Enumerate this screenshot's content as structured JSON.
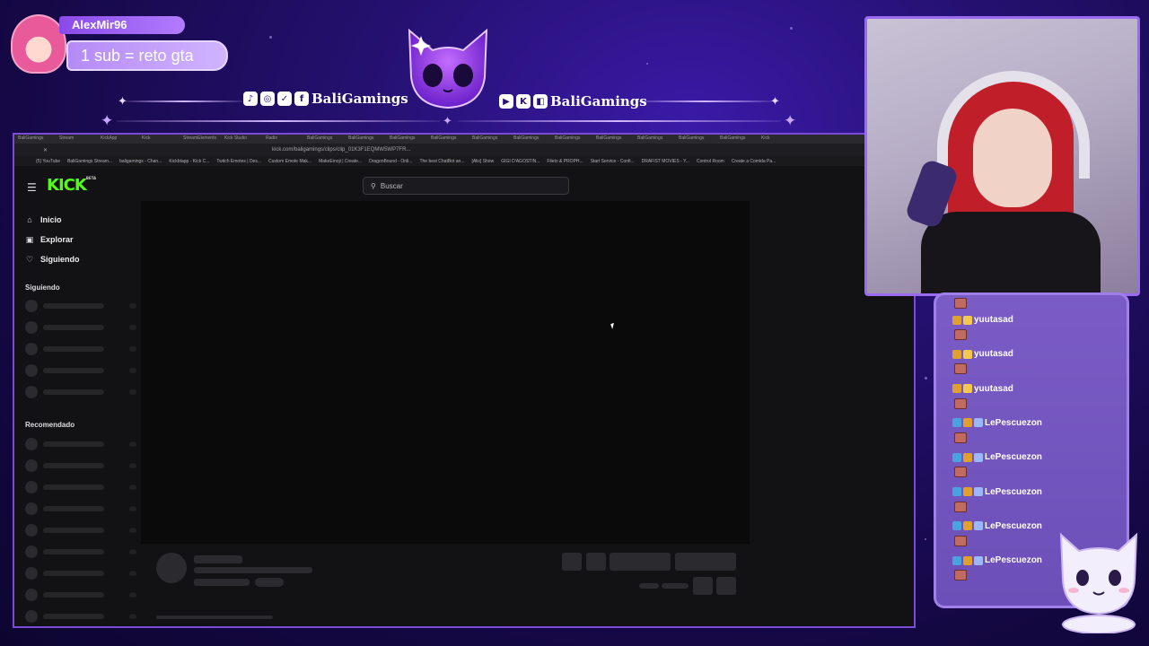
{
  "alert": {
    "username": "AlexMir96",
    "message": "1 sub = reto gta"
  },
  "socials": {
    "left_handle": "BaliGamings",
    "right_handle": "BaliGamings",
    "left_icons": [
      "tiktok-icon",
      "instagram-icon",
      "twitter-icon",
      "facebook-icon"
    ],
    "right_icons": [
      "youtube-icon",
      "kick-icon",
      "twitch-icon"
    ]
  },
  "browser": {
    "tabs": [
      "BaliGamings",
      "Stream",
      "KickApp",
      "Kick",
      "StreamElements",
      "Kick Studio",
      "Radio",
      "BaliGamings",
      "BaliGamings",
      "BaliGamings",
      "BaliGamings",
      "BaliGamings",
      "BaliGamings",
      "BaliGamings",
      "BaliGamings",
      "BaliGamings",
      "BaliGamings",
      "BaliGamings",
      "Kick"
    ],
    "url": "kick.com/baligamings/clips/clip_01K3F1EQMW5WP7FR...",
    "bookmarks": [
      "(5) YouTube",
      "BaliGamings Stream...",
      "baligamings - Chan...",
      "Kickbtapp - Kick C...",
      "Twitch Emotes | Des...",
      "Custom Emote Mak...",
      "MakeEmoji | Create...",
      "DragonBound - Onli...",
      "The best ChatBot an...",
      "[Alix] Show",
      "GIGI D'AGOSTIN...",
      "Fileto & PROPH...",
      "Start Service - Confi...",
      "DRAFIST MOVIES - Y...",
      "Control Room",
      "Create a Comida Pa..."
    ]
  },
  "kick": {
    "logo": "KICK",
    "logo_tag": "BETA",
    "search_placeholder": "Buscar",
    "nav": [
      {
        "label": "Inicio",
        "icon": "home-icon"
      },
      {
        "label": "Explorar",
        "icon": "compass-icon"
      },
      {
        "label": "Siguiendo",
        "icon": "heart-icon"
      }
    ],
    "following_label": "Siguiendo",
    "recommended_label": "Recomendado"
  },
  "chat": {
    "messages": [
      {
        "user": "yuutasad"
      },
      {
        "user": "yuutasad"
      },
      {
        "user": "yuutasad"
      },
      {
        "user": "LePescuezon"
      },
      {
        "user": "LePescuezon"
      },
      {
        "user": "LePescuezon"
      },
      {
        "user": "LePescuezon"
      },
      {
        "user": "LePescuezon"
      }
    ]
  },
  "colors": {
    "kick_green": "#53fc18",
    "overlay_purple": "#9a6af0",
    "chat_bg": "#7b5cc6"
  }
}
